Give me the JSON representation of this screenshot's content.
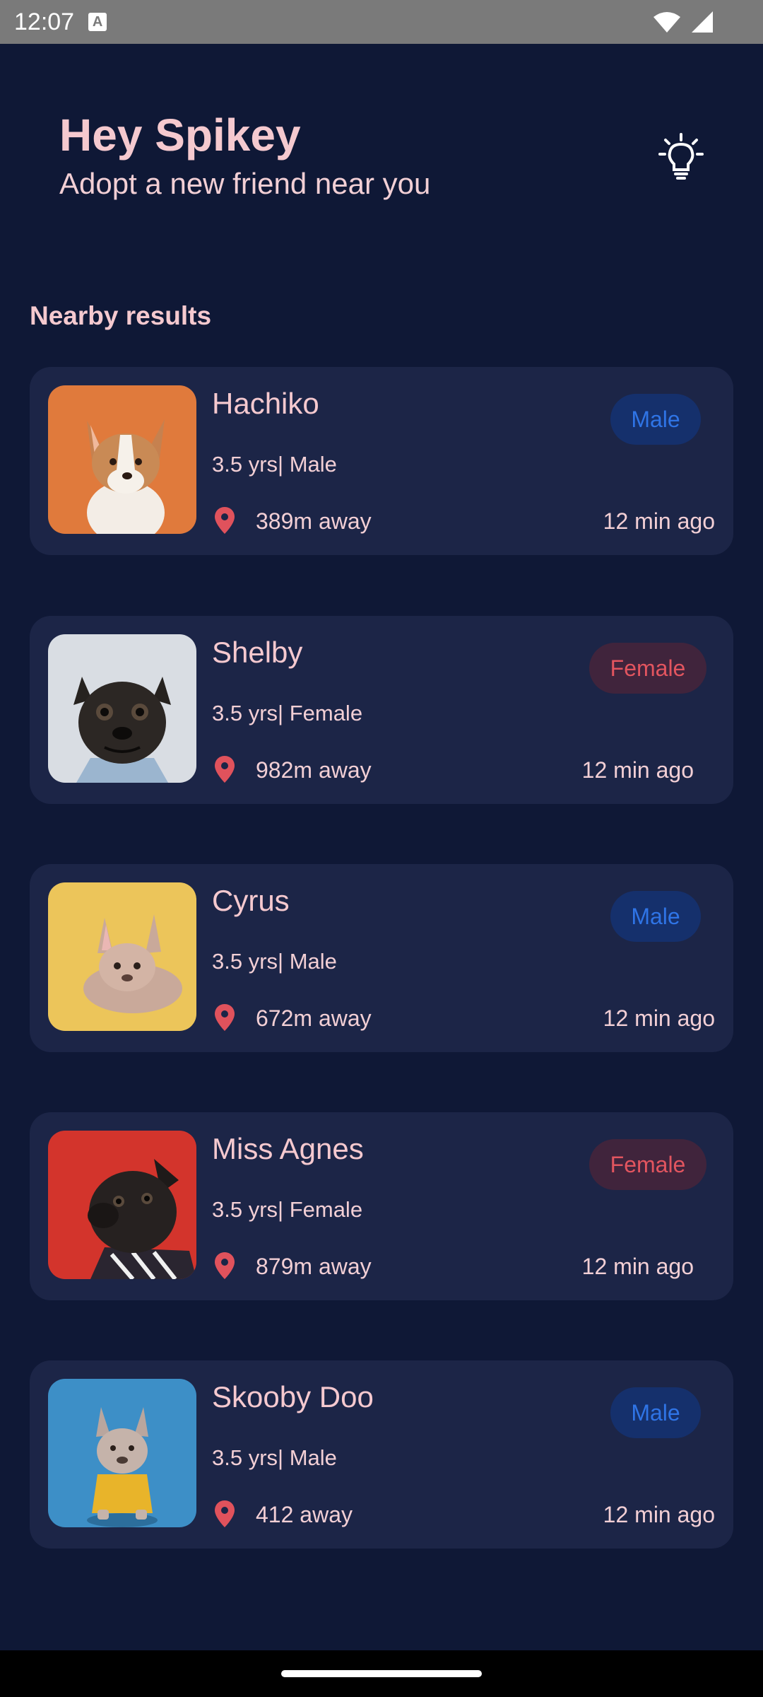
{
  "status_bar": {
    "time": "12:07",
    "keyboard_badge": "A",
    "icons": [
      "wifi-icon",
      "cellular-signal-icon"
    ]
  },
  "header": {
    "greeting": "Hey Spikey",
    "subtitle": "Adopt a new friend near you",
    "action_icon": "lightbulb-icon"
  },
  "section_title": "Nearby results",
  "colors": {
    "background": "#0f1836",
    "card": "#1c2547",
    "text_pink": "#f5c9cf",
    "male_badge_bg": "#15306c",
    "male_badge_text": "#2f74e6",
    "female_badge_bg": "#40243c",
    "female_badge_text": "#e2555f",
    "pin": "#e0525c"
  },
  "pets": [
    {
      "name": "Hachiko",
      "meta": "3.5 yrs| Male",
      "distance": "389m away",
      "time": "12 min ago",
      "gender_label": "Male",
      "gender": "male",
      "photo_icon": "corgi-puppy-photo"
    },
    {
      "name": "Shelby",
      "meta": "3.5 yrs| Female",
      "distance": "982m away",
      "time": "12 min ago",
      "gender_label": "Female",
      "gender": "female",
      "photo_icon": "pug-photo"
    },
    {
      "name": "Cyrus",
      "meta": "3.5 yrs| Male",
      "distance": "672m away",
      "time": "12 min ago",
      "gender_label": "Male",
      "gender": "male",
      "photo_icon": "french-bulldog-lying-photo"
    },
    {
      "name": "Miss Agnes",
      "meta": "3.5 yrs| Female",
      "distance": "879m away",
      "time": "12 min ago",
      "gender_label": "Female",
      "gender": "female",
      "photo_icon": "black-pug-photo"
    },
    {
      "name": "Skooby Doo",
      "meta": "3.5 yrs| Male",
      "distance": "412 away",
      "time": "12 min ago",
      "gender_label": "Male",
      "gender": "male",
      "photo_icon": "french-bulldog-shirt-photo"
    }
  ]
}
